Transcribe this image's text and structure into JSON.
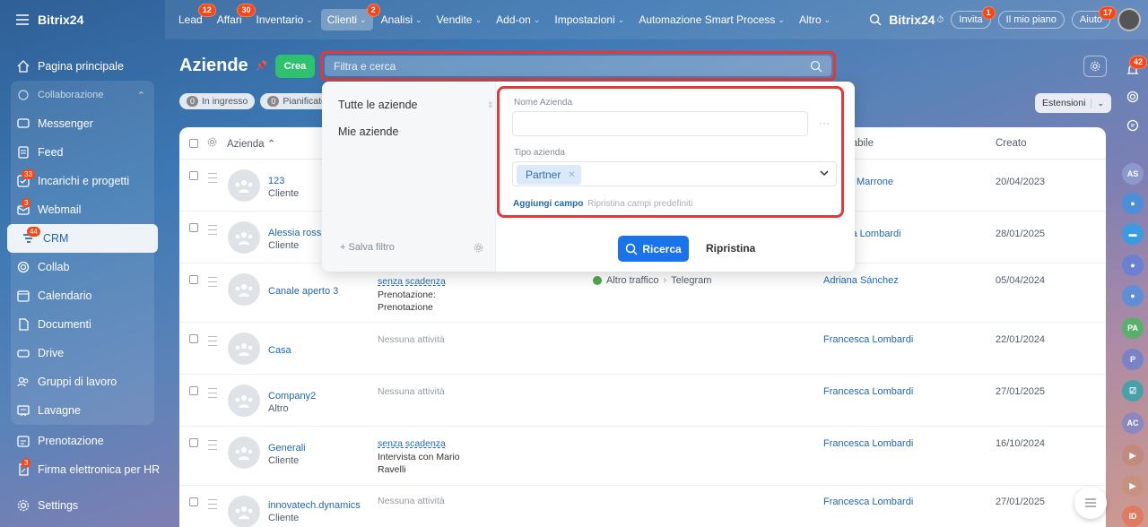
{
  "brand": "Bitrix24",
  "nav": [
    {
      "label": "Lead",
      "badge": "12"
    },
    {
      "label": "Affari",
      "badge": "30"
    },
    {
      "label": "Inventario",
      "caret": true
    },
    {
      "label": "Clienti",
      "badge": "2",
      "caret": true,
      "active": true
    },
    {
      "label": "Analisi",
      "caret": true
    },
    {
      "label": "Vendite",
      "caret": true
    },
    {
      "label": "Add-on",
      "caret": true
    },
    {
      "label": "Impostazioni",
      "caret": true
    },
    {
      "label": "Automazione Smart Process",
      "caret": true
    },
    {
      "label": "Altro",
      "caret": true
    }
  ],
  "topright": {
    "brand": "Bitrix24",
    "invite": "Invita",
    "invite_badge": "1",
    "plan": "Il mio piano",
    "help": "Aiuto",
    "help_badge": "17"
  },
  "sidebar": {
    "home": "Pagina principale",
    "collab_group": "Collaborazione",
    "messenger": "Messenger",
    "feed": "Feed",
    "tasks": "Incarichi e progetti",
    "tasks_badge": "33",
    "webmail": "Webmail",
    "webmail_badge": "3",
    "crm": "CRM",
    "crm_badge": "44",
    "collab": "Collab",
    "calendar": "Calendario",
    "documents": "Documenti",
    "drive": "Drive",
    "groups": "Gruppi di lavoro",
    "boards": "Lavagne",
    "booking": "Prenotazione",
    "esign": "Firma elettronica per HR",
    "esign_badge": "3",
    "settings": "Settings"
  },
  "page": {
    "title": "Aziende",
    "create": "Crea",
    "search_placeholder": "Filtra e cerca",
    "extensions": "Estensioni"
  },
  "counters": [
    {
      "n": "0",
      "label": "In ingresso"
    },
    {
      "n": "0",
      "label": "Pianificato"
    }
  ],
  "grid": {
    "col_company": "Azienda",
    "col_resp": "sabile",
    "col_created": "Creato",
    "rows": [
      {
        "name": "123",
        "type": "Cliente",
        "activity": "",
        "activity_sub": "",
        "source": "",
        "resp": "Marrone",
        "created": "20/04/2023"
      },
      {
        "name": "Alessia rossi",
        "type": "Cliente",
        "activity": "",
        "activity_sub": "",
        "source": "",
        "resp": "ca Lombardi",
        "created": "28/01/2025"
      },
      {
        "name": "Canale aperto 3",
        "type": "",
        "activity": "senza scadenza",
        "activity_sub": "Prenotazione: Prenotazione",
        "source": "Altro traffico",
        "source2": "Telegram",
        "resp": "Adriana Sánchez",
        "created": "05/04/2024"
      },
      {
        "name": "Casa",
        "type": "",
        "activity": "Nessuna attività",
        "activity_sub": "",
        "source": "",
        "resp": "Francesca Lombardi",
        "created": "22/01/2024"
      },
      {
        "name": "Company2",
        "type": "Altro",
        "activity": "Nessuna attività",
        "activity_sub": "",
        "source": "",
        "resp": "Francesca Lombardi",
        "created": "27/01/2025"
      },
      {
        "name": "Generali",
        "type": "Cliente",
        "activity": "senza scadenza",
        "activity_sub": "Intervista con Mario Ravelli",
        "source": "",
        "resp": "Francesca Lombardi",
        "created": "16/10/2024"
      },
      {
        "name": "innovatech.dynamics",
        "type": "Cliente",
        "activity": "Nessuna attività",
        "activity_sub": "",
        "source": "",
        "resp": "Francesca Lombardi",
        "created": "27/01/2025"
      }
    ]
  },
  "filter": {
    "presets": [
      "Tutte le aziende",
      "Mie aziende"
    ],
    "save": "+ Salva filtro",
    "name_label": "Nome Azienda",
    "name_value": "",
    "type_label": "Tipo azienda",
    "type_tag": "Partner",
    "add_field": "Aggiungi campo",
    "reset_fields": "Ripristina campi predefiniti",
    "search_btn": "Ricerca",
    "reset_btn": "Ripristina"
  },
  "rail": {
    "notif_badge": "42",
    "avatars": [
      "AS",
      "PA",
      "P",
      "AC",
      "ID"
    ]
  },
  "colors": {
    "accent": "#1a73e8",
    "create": "#2fc26e",
    "highlight": "#e5383b",
    "badge": "#f54819"
  }
}
